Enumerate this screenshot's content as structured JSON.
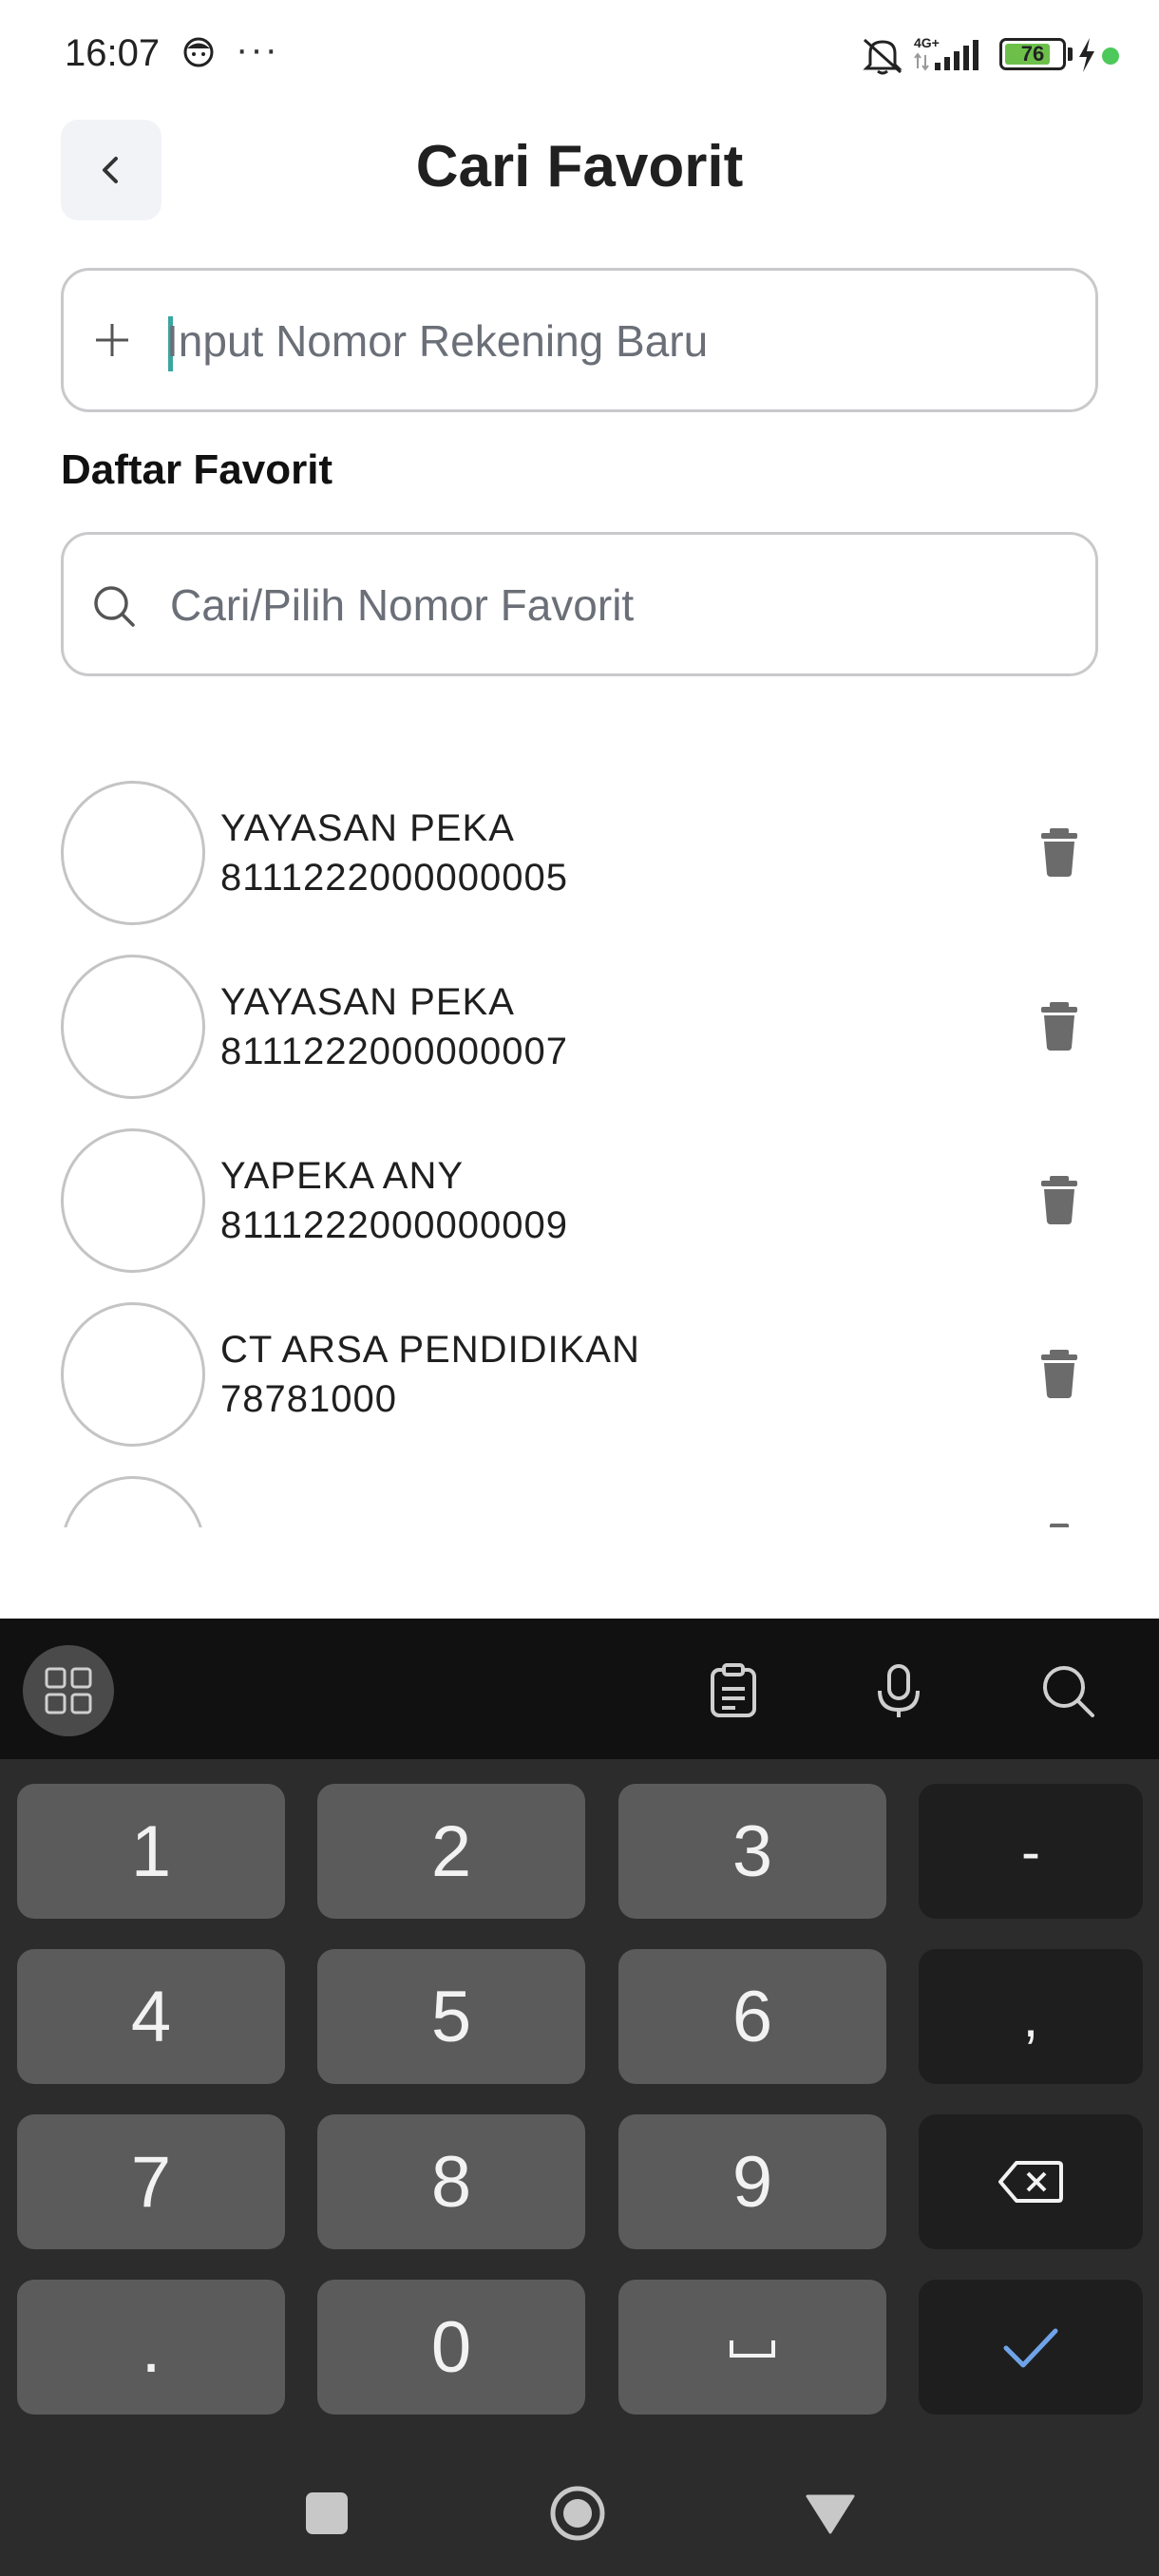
{
  "status_bar": {
    "time": "16:07",
    "dots": "···",
    "network": "4G+",
    "battery": "76"
  },
  "header": {
    "title": "Cari Favorit",
    "back_icon": "chevron-left-icon"
  },
  "new_account": {
    "placeholder": "Input Nomor Rekening Baru",
    "icon": "plus-icon"
  },
  "favorites": {
    "section_title": "Daftar Favorit",
    "search_placeholder": "Cari/Pilih Nomor Favorit",
    "items": [
      {
        "name": "YAYASAN PEKA",
        "number": "8111222000000005"
      },
      {
        "name": "YAYASAN PEKA",
        "number": "8111222000000007"
      },
      {
        "name": "YAPEKA ANY",
        "number": "8111222000000009"
      },
      {
        "name": "CT ARSA PENDIDIKAN",
        "number": "78781000"
      }
    ]
  },
  "keyboard": {
    "toolbar_icons": [
      "apps-grid-icon",
      "clipboard-icon",
      "microphone-icon",
      "search-icon"
    ],
    "rows": [
      [
        "1",
        "2",
        "3",
        "-"
      ],
      [
        "4",
        "5",
        "6",
        ","
      ],
      [
        "7",
        "8",
        "9",
        "backspace"
      ],
      [
        ".",
        "0",
        "space",
        "done"
      ]
    ],
    "keys": {
      "k1": "1",
      "k2": "2",
      "k3": "3",
      "dash": "-",
      "k4": "4",
      "k5": "5",
      "k6": "6",
      "comma": ",",
      "k7": "7",
      "k8": "8",
      "k9": "9",
      "dot": ".",
      "k0": "0",
      "space": "␣"
    },
    "accent_color": "#6fa3e8"
  },
  "colors": {
    "caret": "#3aa6a0",
    "battery_fill": "#6cc04a",
    "status_dot": "#4cc95a"
  }
}
